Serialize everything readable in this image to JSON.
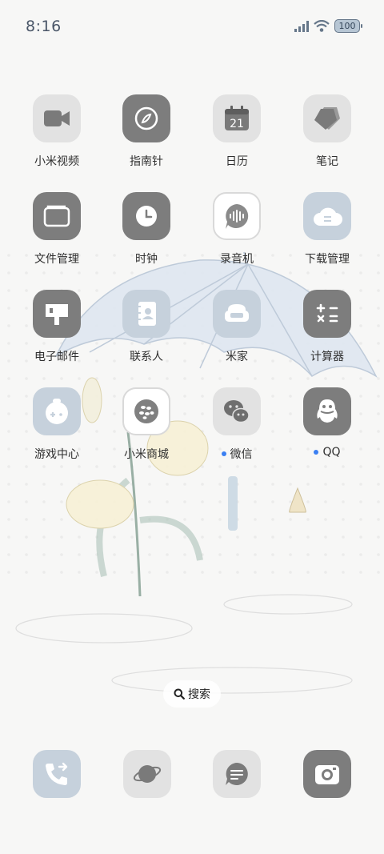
{
  "status_bar": {
    "time": "8:16",
    "battery": "100",
    "icons": [
      "signal-icon",
      "wifi-icon",
      "battery-icon"
    ]
  },
  "apps": [
    {
      "label": "小米视频",
      "icon": "video-camera-icon"
    },
    {
      "label": "指南针",
      "icon": "compass-icon"
    },
    {
      "label": "日历",
      "icon": "calendar-icon",
      "date": "21"
    },
    {
      "label": "笔记",
      "icon": "notes-tag-icon"
    },
    {
      "label": "文件管理",
      "icon": "folder-icon"
    },
    {
      "label": "时钟",
      "icon": "clock-icon"
    },
    {
      "label": "录音机",
      "icon": "voice-recorder-icon"
    },
    {
      "label": "下载管理",
      "icon": "cloud-download-icon"
    },
    {
      "label": "电子邮件",
      "icon": "mailbox-icon"
    },
    {
      "label": "联系人",
      "icon": "contacts-book-icon"
    },
    {
      "label": "米家",
      "icon": "sofa-icon"
    },
    {
      "label": "计算器",
      "icon": "calculator-icon"
    },
    {
      "label": "游戏中心",
      "icon": "game-controller-icon"
    },
    {
      "label": "小米商城",
      "icon": "mi-store-icon"
    },
    {
      "label": "微信",
      "icon": "wechat-icon",
      "new_dot": true
    },
    {
      "label": "QQ",
      "icon": "qq-penguin-icon",
      "new_dot": true
    }
  ],
  "search": {
    "label": "搜索",
    "icon": "search-icon"
  },
  "dock": [
    {
      "name": "phone",
      "icon": "phone-icon"
    },
    {
      "name": "browser",
      "icon": "planet-icon"
    },
    {
      "name": "messages",
      "icon": "message-bubble-icon"
    },
    {
      "name": "camera",
      "icon": "camera-icon"
    }
  ],
  "colors": {
    "icon_gray": "#e2e2e2",
    "icon_dark": "#7d7d7d",
    "icon_blue": "#c6d1dc",
    "notification_dot": "#3a7ff2",
    "status_text": "#4a5668"
  }
}
